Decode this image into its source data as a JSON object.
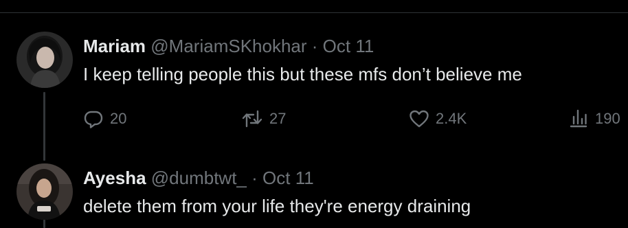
{
  "tweets": [
    {
      "author": {
        "name": "Mariam",
        "handle": "@MariamSKhokhar",
        "avatar_icon": "avatar-photo"
      },
      "separator": "·",
      "date": "Oct 11",
      "text": "I keep telling people this but these mfs don’t believe me",
      "stats": {
        "replies": "20",
        "reposts": "27",
        "likes": "2.4K",
        "views": "190"
      }
    },
    {
      "author": {
        "name": "Ayesha",
        "handle": "@dumbtwt_",
        "avatar_icon": "avatar-photo"
      },
      "separator": "·",
      "date": "Oct 11",
      "text": "delete them from your life they're energy draining"
    }
  ],
  "icons": {
    "reply": "reply-icon",
    "repost": "repost-icon",
    "like": "heart-icon",
    "views": "analytics-icon"
  },
  "colors": {
    "background": "#000000",
    "primary_text": "#e7e9ea",
    "secondary_text": "#71767b",
    "divider": "#2f3336"
  }
}
